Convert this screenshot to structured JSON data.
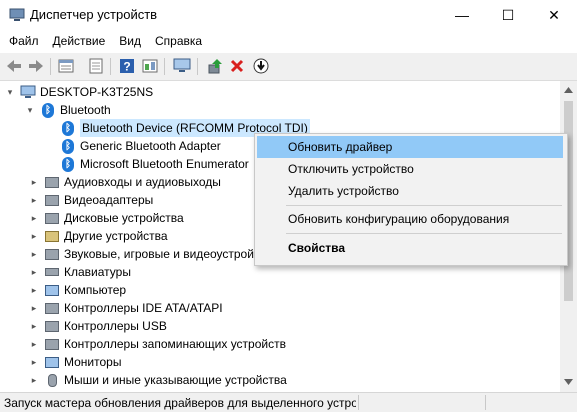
{
  "window": {
    "title": "Диспетчер устройств",
    "minimize_glyph": "—",
    "maximize_glyph": "☐",
    "close_glyph": "✕"
  },
  "menu": [
    "Файл",
    "Действие",
    "Вид",
    "Справка"
  ],
  "toolbar_icons": [
    "back-icon",
    "forward-icon",
    "properties-icon",
    "device-list-icon",
    "help-icon",
    "resources-icon",
    "monitor-icon",
    "update-driver-icon",
    "remove-device-icon",
    "scan-hardware-icon"
  ],
  "tree": {
    "computer": "DESKTOP-K3T25NS",
    "bluetooth": {
      "label": "Bluetooth",
      "children": [
        "Bluetooth Device (RFCOMM Protocol TDI)",
        "Generic Bluetooth Adapter",
        "Microsoft Bluetooth Enumerator"
      ]
    },
    "categories": [
      {
        "label": "Аудиовходы и аудиовыходы",
        "icon": "audio-icon"
      },
      {
        "label": "Видеоадаптеры",
        "icon": "display-adapter-icon"
      },
      {
        "label": "Дисковые устройства",
        "icon": "disk-drive-icon"
      },
      {
        "label": "Другие устройства",
        "icon": "other-devices-icon"
      },
      {
        "label": "Звуковые, игровые и видеоустройства",
        "icon": "sound-icon"
      },
      {
        "label": "Клавиатуры",
        "icon": "keyboard-icon"
      },
      {
        "label": "Компьютер",
        "icon": "computer-icon"
      },
      {
        "label": "Контроллеры IDE ATA/ATAPI",
        "icon": "ide-controller-icon"
      },
      {
        "label": "Контроллеры USB",
        "icon": "usb-controller-icon"
      },
      {
        "label": "Контроллеры запоминающих устройств",
        "icon": "storage-controller-icon"
      },
      {
        "label": "Мониторы",
        "icon": "monitor-icon"
      },
      {
        "label": "Мыши и иные указывающие устройства",
        "icon": "mouse-icon"
      }
    ]
  },
  "context_menu": {
    "update_driver": "Обновить драйвер",
    "disable_device": "Отключить устройство",
    "uninstall_device": "Удалить устройство",
    "scan_hardware": "Обновить конфигурацию оборудования",
    "properties": "Свойства"
  },
  "status": "Запуск мастера обновления драйверов для выделенного устройства.",
  "colors": {
    "bluetooth": "#1e78d7",
    "highlight": "#91c9f7",
    "selection": "#cce8ff",
    "remove": "#d9201e",
    "update": "#2a9d3a"
  }
}
